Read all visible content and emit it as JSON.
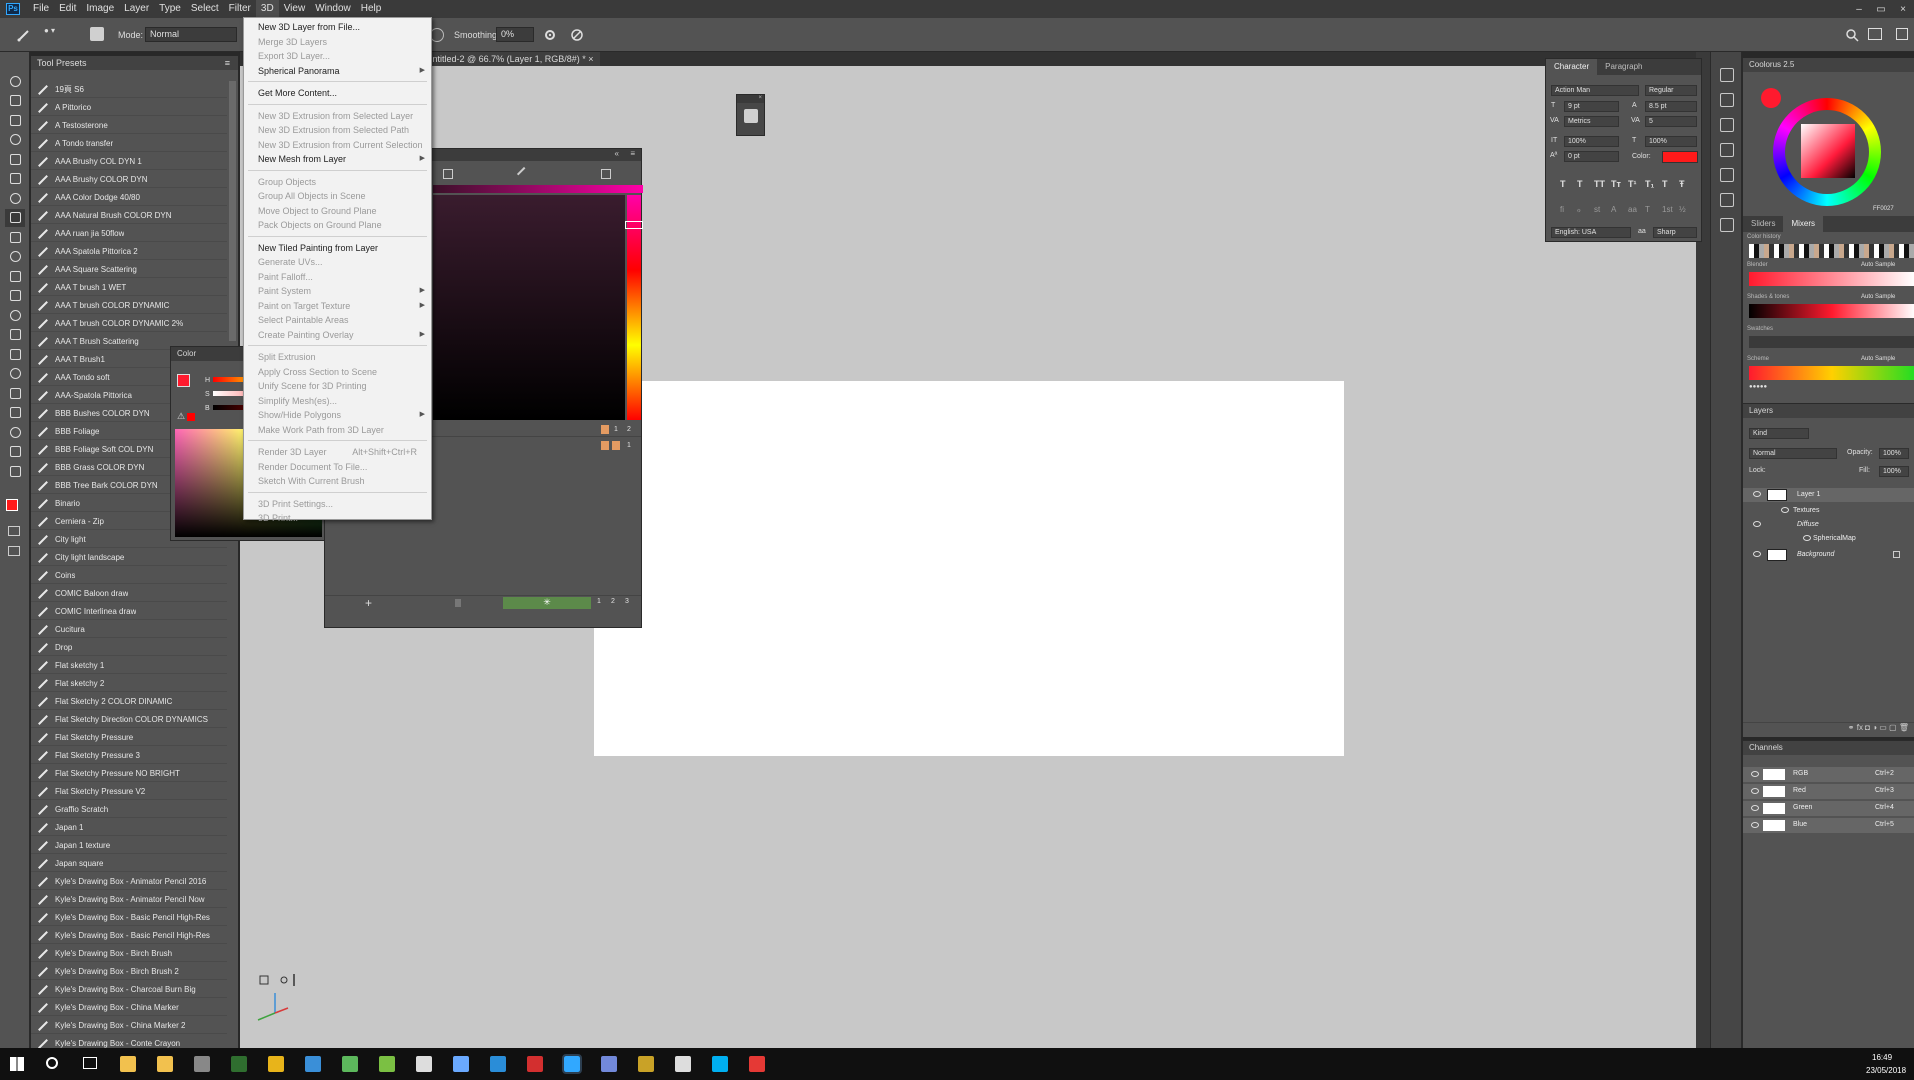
{
  "menubar": {
    "items": [
      "File",
      "Edit",
      "Image",
      "Layer",
      "Type",
      "Select",
      "Filter",
      "3D",
      "View",
      "Window",
      "Help"
    ],
    "active": "3D",
    "logo": "Ps"
  },
  "options": {
    "mode_label": "Mode:",
    "mode_value": "Normal",
    "smoothing_label": "Smoothing:",
    "smoothing_value": "0%"
  },
  "document": {
    "tab_title": "Untitled-2 @ 66.7% (Layer 1, RGB/8#) *",
    "tab_close": "×"
  },
  "tool_presets": {
    "title": "Tool Presets",
    "items": [
      "19頁 S6",
      "A Pittorico",
      "A Testosterone",
      "A Tondo transfer",
      "AAA Brushy COL DYN 1",
      "AAA Brushy COLOR DYN",
      "AAA Color Dodge 40/80",
      "AAA Natural Brush COLOR DYN",
      "AAA ruan jia 50flow",
      "AAA Spatola Pittorica 2",
      "AAA Square Scattering",
      "AAA T brush 1 WET",
      "AAA T brush COLOR DYNAMIC",
      "AAA T brush COLOR DYNAMIC 2%",
      "AAA T Brush Scattering",
      "AAA T Brush1",
      "AAA Tondo soft",
      "AAA-Spatola Pittorica",
      "BBB Bushes COLOR DYN",
      "BBB Foliage",
      "BBB Foliage Soft COL DYN",
      "BBB Grass COLOR DYN",
      "BBB Tree Bark COLOR DYN",
      "Binario",
      "Cerniera - Zip",
      "City light",
      "City light landscape",
      "Coins",
      "COMIC Baloon draw",
      "COMIC Interlinea draw",
      "Cucitura",
      "Drop",
      "Flat sketchy 1",
      "Flat sketchy 2",
      "Flat Sketchy 2 COLOR DINAMIC",
      "Flat Sketchy Direction COLOR DYNAMICS",
      "Flat Sketchy Pressure",
      "Flat Sketchy Pressure 3",
      "Flat Sketchy Pressure NO BRIGHT",
      "Flat Sketchy Pressure V2",
      "Graffio Scratch",
      "Japan 1",
      "Japan 1 texture",
      "Japan square",
      "Kyle's Drawing Box - Animator Pencil 2016",
      "Kyle's Drawing Box - Animator Pencil Now",
      "Kyle's Drawing Box - Basic Pencil High-Res",
      "Kyle's Drawing Box - Basic Pencil High-Res",
      "Kyle's Drawing Box - Birch Brush",
      "Kyle's Drawing Box - Birch Brush 2",
      "Kyle's Drawing Box - Charcoal Burn Big",
      "Kyle's Drawing Box - China Marker",
      "Kyle's Drawing Box - China Marker 2",
      "Kyle's Drawing Box - Conte Crayon"
    ]
  },
  "color_panel": {
    "title": "Color",
    "labels": [
      "H",
      "S",
      "B"
    ]
  },
  "menu_3d": {
    "items": [
      {
        "label": "New 3D Layer from File...",
        "enabled": true
      },
      {
        "label": "Merge 3D Layers",
        "enabled": false
      },
      {
        "label": "Export 3D Layer...",
        "enabled": false
      },
      {
        "label": "Spherical Panorama",
        "enabled": true,
        "submenu": true
      },
      {
        "sep": true
      },
      {
        "label": "Get More Content...",
        "enabled": true
      },
      {
        "sep": true
      },
      {
        "label": "New 3D Extrusion from Selected Layer",
        "enabled": false
      },
      {
        "label": "New 3D Extrusion from Selected Path",
        "enabled": false
      },
      {
        "label": "New 3D Extrusion from Current Selection",
        "enabled": false
      },
      {
        "label": "New Mesh from Layer",
        "enabled": true,
        "submenu": true
      },
      {
        "sep": true
      },
      {
        "label": "Group Objects",
        "enabled": false
      },
      {
        "label": "Group All Objects in Scene",
        "enabled": false
      },
      {
        "label": "Move Object to Ground Plane",
        "enabled": false
      },
      {
        "label": "Pack Objects on Ground Plane",
        "enabled": false
      },
      {
        "sep": true
      },
      {
        "label": "New Tiled Painting from Layer",
        "enabled": true
      },
      {
        "label": "Generate UVs...",
        "enabled": false
      },
      {
        "label": "Paint Falloff...",
        "enabled": false
      },
      {
        "label": "Paint System",
        "enabled": false,
        "submenu": true
      },
      {
        "label": "Paint on Target Texture",
        "enabled": false,
        "submenu": true
      },
      {
        "label": "Select Paintable Areas",
        "enabled": false
      },
      {
        "label": "Create Painting Overlay",
        "enabled": false,
        "submenu": true
      },
      {
        "sep": true
      },
      {
        "label": "Split Extrusion",
        "enabled": false
      },
      {
        "label": "Apply Cross Section to Scene",
        "enabled": false
      },
      {
        "label": "Unify Scene for 3D Printing",
        "enabled": false
      },
      {
        "label": "Simplify Mesh(es)...",
        "enabled": false
      },
      {
        "label": "Show/Hide Polygons",
        "enabled": false,
        "submenu": true
      },
      {
        "label": "Make Work Path from 3D Layer",
        "enabled": false
      },
      {
        "sep": true
      },
      {
        "label": "Render 3D Layer",
        "enabled": false,
        "shortcut": "Alt+Shift+Ctrl+R"
      },
      {
        "label": "Render Document To File...",
        "enabled": false
      },
      {
        "label": "Sketch With Current Brush",
        "enabled": false
      },
      {
        "sep": true
      },
      {
        "label": "3D Print Settings...",
        "enabled": false
      },
      {
        "label": "3D Print...",
        "enabled": false
      }
    ]
  },
  "panel_3d": {
    "footer_nums": [
      "1",
      "2",
      "3"
    ],
    "row_nums": [
      "1",
      "2",
      "3",
      "1"
    ]
  },
  "character": {
    "tabs": [
      "Character",
      "Paragraph"
    ],
    "font": "Action Man",
    "style": "Regular",
    "size": "9 pt",
    "leading": "8.5 pt",
    "kerning": "Metrics",
    "tracking": "5",
    "vscale": "100%",
    "hscale": "100%",
    "baseline": "0 pt",
    "color_label": "Color:",
    "language": "English: USA",
    "aa": "Sharp",
    "glyph_buttons": [
      "T",
      "T",
      "TT",
      "Tт",
      "T¹",
      "T₁",
      "T",
      "Ŧ"
    ],
    "ot_buttons": [
      "fi",
      "ℴ",
      "st",
      "A",
      "aa",
      "T",
      "1st",
      "½"
    ]
  },
  "coloruspanel": {
    "title": "Coolorus 2.5",
    "hex": "FF0027",
    "tabs": [
      "Sliders",
      "Mixers"
    ],
    "sections": [
      "Color history",
      "Blender",
      "Shades & tones",
      "Swatches",
      "Scheme"
    ],
    "auto_sample": "Auto Sample",
    "colors": {
      "accent": "#ff1a2e"
    }
  },
  "layers": {
    "title": "Layers",
    "kind": "Kind",
    "blend": "Normal",
    "opacity_label": "Opacity:",
    "opacity": "100%",
    "lock_label": "Lock:",
    "fill_label": "Fill:",
    "fill": "100%",
    "items": [
      "Layer 1",
      "Textures",
      "Diffuse",
      "SphericalMap",
      "Background"
    ]
  },
  "channels": {
    "title": "Channels",
    "items": [
      {
        "name": "RGB",
        "shortcut": "Ctrl+2"
      },
      {
        "name": "Red",
        "shortcut": "Ctrl+3"
      },
      {
        "name": "Green",
        "shortcut": "Ctrl+4"
      },
      {
        "name": "Blue",
        "shortcut": "Ctrl+5"
      }
    ]
  },
  "taskbar": {
    "time": "16:49",
    "date": "23/05/2018"
  },
  "window": {
    "controls": [
      "–",
      "▭",
      "×"
    ]
  }
}
